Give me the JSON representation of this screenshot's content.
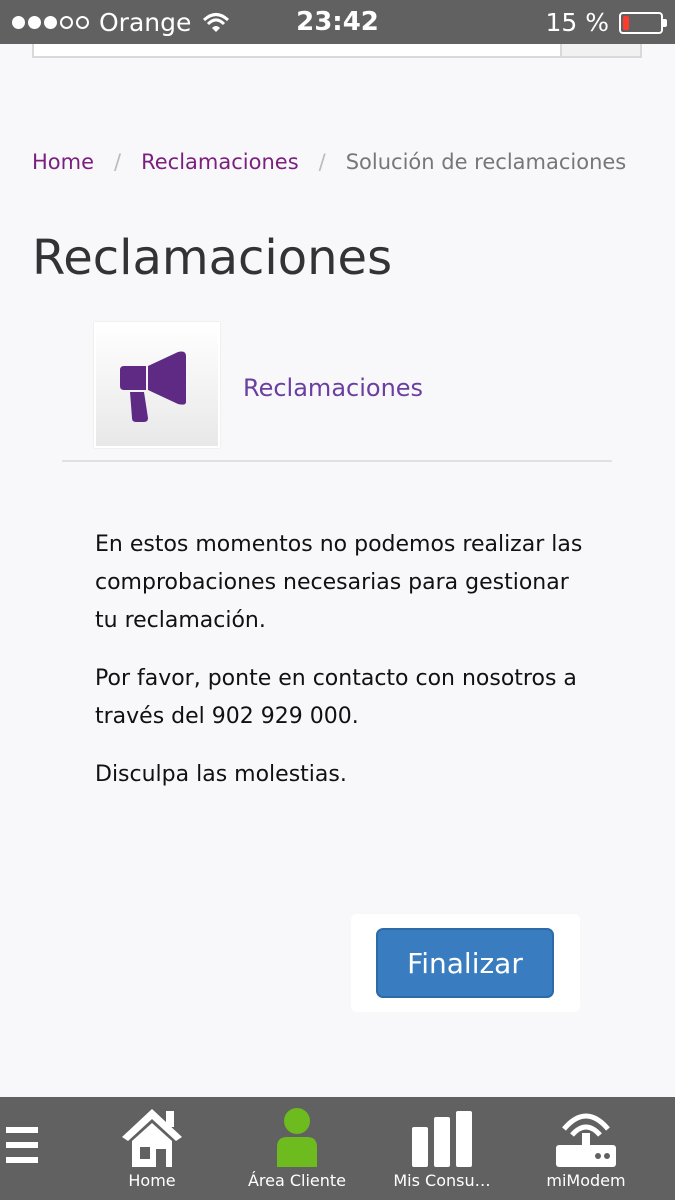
{
  "status_bar": {
    "carrier": "Orange",
    "time": "23:42",
    "battery_percent": "15 %",
    "battery_level": 0.15
  },
  "breadcrumb": {
    "items": [
      "Home",
      "Reclamaciones"
    ],
    "separator": "/",
    "current": "Solución de reclamaciones"
  },
  "page": {
    "title": "Reclamaciones",
    "product": {
      "icon": "megaphone-icon",
      "name": "Reclamaciones"
    },
    "message": [
      "En estos momentos no podemos realizar las comprobaciones necesarias para gestionar tu reclamación.",
      "Por favor, ponte en contacto con nosotros a través del 902 929 000.",
      "Disculpa las molestias."
    ],
    "finalize_label": "Finalizar"
  },
  "bottom_nav": {
    "items": [
      {
        "label": "Home",
        "icon": "house-icon"
      },
      {
        "label": "Área Cliente",
        "icon": "user-icon"
      },
      {
        "label": "Mis Consu…",
        "icon": "bar-chart-icon"
      },
      {
        "label": "miModem",
        "icon": "router-icon"
      }
    ]
  },
  "colors": {
    "link": "#7b1f7f",
    "product_accent": "#5e2a84",
    "button": "#3a7cc0",
    "nav_bg": "#616161",
    "user_icon": "#6dbb1f"
  }
}
